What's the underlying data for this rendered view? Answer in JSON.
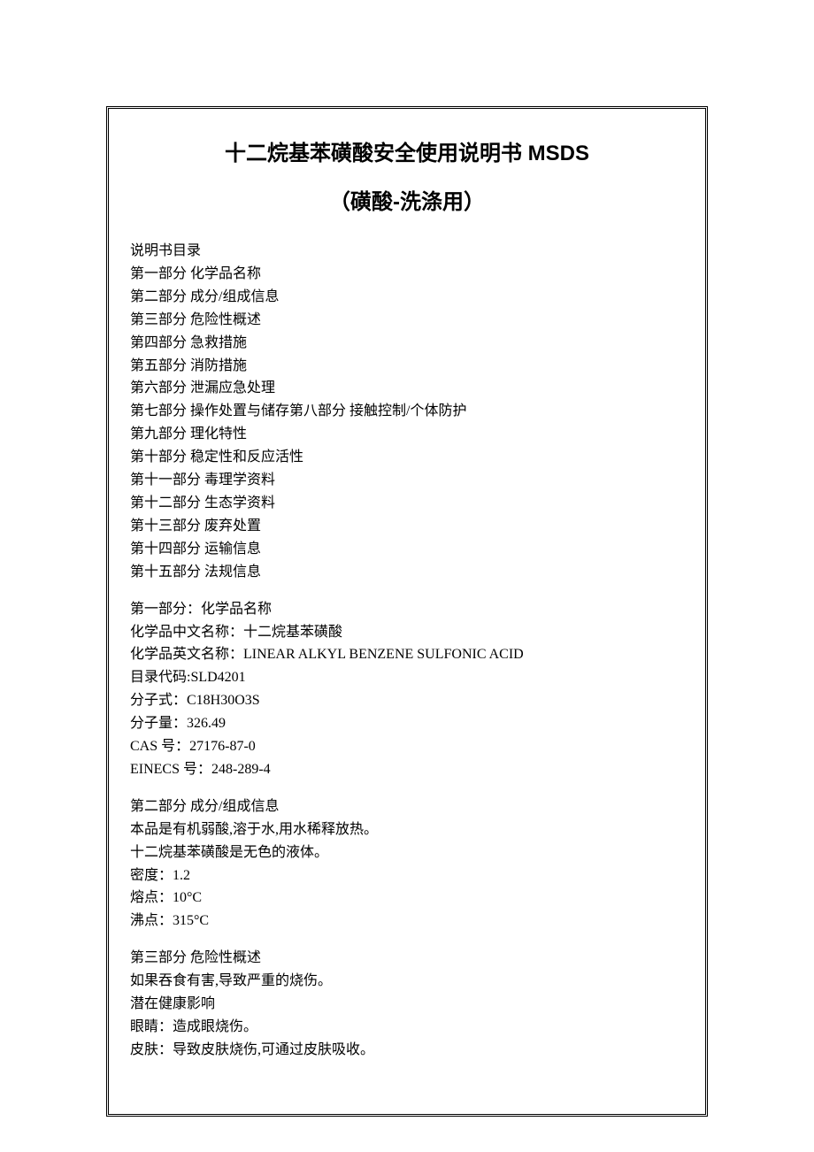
{
  "title": "十二烷基苯磺酸安全使用说明书 MSDS",
  "subtitle": "（磺酸-洗涤用）",
  "toc_header": "说明书目录",
  "toc": [
    "第一部分 化学品名称",
    "第二部分 成分/组成信息",
    "第三部分 危险性概述",
    "第四部分 急救措施",
    "第五部分 消防措施",
    "第六部分 泄漏应急处理",
    "第七部分 操作处置与储存第八部分 接触控制/个体防护",
    "第九部分 理化特性",
    "第十部分 稳定性和反应活性",
    "第十一部分 毒理学资料",
    "第十二部分 生态学资料",
    "第十三部分 废弃处置",
    "第十四部分 运输信息",
    "第十五部分 法规信息"
  ],
  "section1": {
    "header": "第一部分：化学品名称",
    "lines": [
      "化学品中文名称：十二烷基苯磺酸",
      "化学品英文名称：LINEAR ALKYL BENZENE SULFONIC ACID",
      "目录代码:SLD4201",
      "分子式：C18H30O3S",
      "分子量：326.49",
      "CAS 号：27176-87-0",
      "EINECS 号：248-289-4"
    ]
  },
  "section2": {
    "header": "第二部分 成分/组成信息",
    "lines": [
      "本品是有机弱酸,溶于水,用水稀释放热。",
      "十二烷基苯磺酸是无色的液体。",
      "密度：1.2",
      "熔点：10°C",
      "沸点：315°C"
    ]
  },
  "section3": {
    "header": "第三部分 危险性概述",
    "lines": [
      "如果吞食有害,导致严重的烧伤。",
      "潜在健康影响",
      "眼睛：造成眼烧伤。",
      "皮肤：导致皮肤烧伤,可通过皮肤吸收。"
    ]
  }
}
